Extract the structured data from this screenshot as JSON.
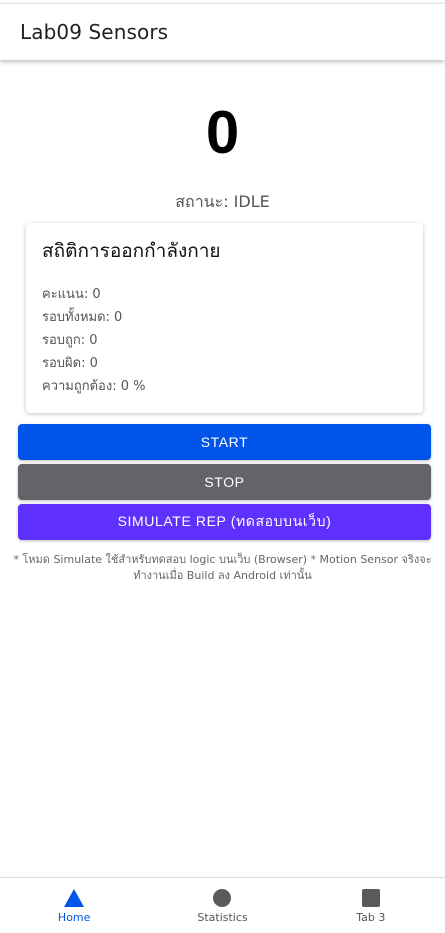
{
  "header": {
    "title": "Lab09 Sensors"
  },
  "counter": {
    "value": "0"
  },
  "status": {
    "text": "สถานะ: IDLE"
  },
  "stats_card": {
    "title": "สถิติการออกกำลังกาย",
    "lines": [
      "คะแนน: 0",
      "รอบทั้งหมด: 0",
      "รอบถูก: 0",
      "รอบผิด: 0",
      "ความถูกต้อง: 0 %"
    ]
  },
  "buttons": {
    "start": "START",
    "stop": "STOP",
    "simulate": "SIMULATE REP (ทดสอบบนเว็บ)"
  },
  "note": "* โหมด Simulate ใช้สำหรับทดสอบ logic บนเว็บ (Browser) * Motion Sensor จริงจะทำงานเมื่อ Build ลง Android เท่านั้น",
  "tabs": [
    {
      "label": "Home",
      "icon": "triangle-icon",
      "active": true
    },
    {
      "label": "Statistics",
      "icon": "ellipse-icon",
      "active": false
    },
    {
      "label": "Tab 3",
      "icon": "square-icon",
      "active": false
    }
  ],
  "colors": {
    "primary": "#0054e9",
    "stop": "#636469",
    "simulate": "#6030ff",
    "tab_inactive_icon": "#5a5a5a"
  }
}
